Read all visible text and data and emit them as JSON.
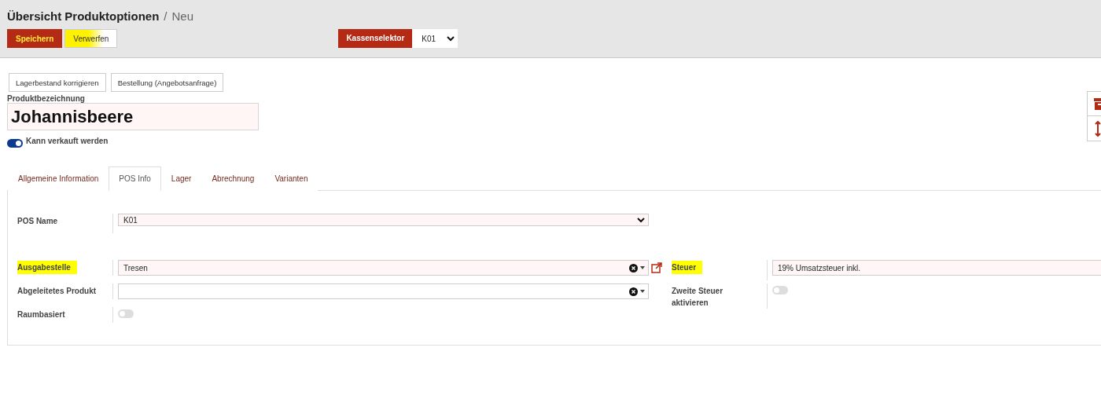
{
  "control_panel": {
    "breadcrumb": [
      {
        "text": "Übersicht Produktoptionen",
        "kind": "current"
      },
      {
        "text": "/",
        "kind": "separator"
      },
      {
        "text": "Neu",
        "kind": "page"
      }
    ],
    "buttons": [
      {
        "label": "Speichern",
        "kind": "primary",
        "highlighted": true
      },
      {
        "label": "Verwerfen",
        "kind": "secondary",
        "highlighted": true
      }
    ],
    "register_selector": {
      "label": "Kassenselektor",
      "value": "K01"
    }
  },
  "header_buttons": [
    "Lagerbestand korrigieren",
    "Bestellung (Angebotsanfrage)"
  ],
  "product": {
    "label": "Produktbezeichnung",
    "name": "Johannisbeere",
    "can_be_sold": {
      "label": "Kann verkauft werden",
      "on": true
    }
  },
  "tabs": [
    {
      "label": "Allgemeine Information",
      "selected": false
    },
    {
      "label": "POS Info",
      "selected": true
    },
    {
      "label": "Lager",
      "selected": false
    },
    {
      "label": "Abrechnung",
      "selected": false
    },
    {
      "label": "Varianten",
      "selected": false
    }
  ],
  "pos_name": {
    "label": "POS Name",
    "value": "K01"
  },
  "left_fields": [
    {
      "label": "Ausgabestelle",
      "kind": "many2one",
      "value": "Tresen",
      "highlighted": true,
      "external_link": true
    },
    {
      "label": "Abgeleitetes Produkt",
      "kind": "many2one",
      "highlighted": false,
      "external_link": false
    },
    {
      "label": "Raumbasiert",
      "kind": "toggle",
      "on": false,
      "highlighted": false
    }
  ],
  "right_fields": [
    {
      "label": "Steuer",
      "kind": "text",
      "value": "19% Umsatzsteuer inkl.",
      "highlighted": true
    },
    {
      "label": "Zweite Steuer aktivieren",
      "kind": "toggle",
      "on": false,
      "highlighted": false
    }
  ]
}
